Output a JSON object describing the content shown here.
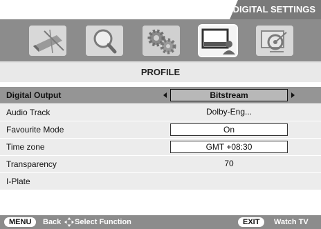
{
  "header": {
    "title": "DIGITAL SETTINGS"
  },
  "icons": [
    {
      "name": "setup-icon",
      "selected": false
    },
    {
      "name": "search-icon",
      "selected": false
    },
    {
      "name": "gears-icon",
      "selected": false
    },
    {
      "name": "monitor-user-icon",
      "selected": true
    },
    {
      "name": "satellite-dish-icon",
      "selected": false
    }
  ],
  "page": {
    "title": "PROFILE"
  },
  "settings": [
    {
      "label": "Digital Output",
      "value": "Bitstream",
      "selected": true
    },
    {
      "label": "Audio Track",
      "value": "Dolby-Eng...",
      "selected": false
    },
    {
      "label": "Favourite Mode",
      "value": "On",
      "selected": false
    },
    {
      "label": "Time zone",
      "value": "GMT +08:30",
      "selected": false
    },
    {
      "label": "Transparency",
      "value": "70",
      "selected": false
    },
    {
      "label": "I-Plate",
      "value": "",
      "selected": false
    }
  ],
  "footer": {
    "menu_key": "MENU",
    "menu_action": "Back",
    "nav_action": "Select Function",
    "exit_key": "EXIT",
    "exit_action": "Watch TV"
  },
  "colors": {
    "bar": "#8c8c8c",
    "selected_row": "#959595",
    "row": "#ececec"
  }
}
